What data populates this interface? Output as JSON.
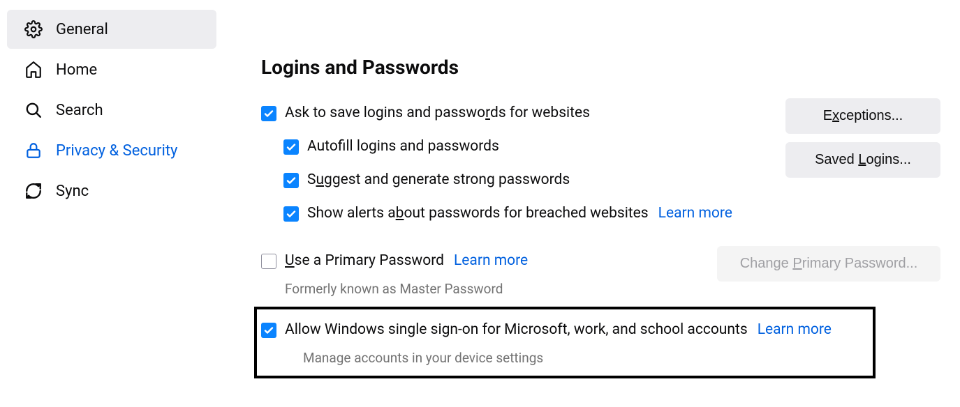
{
  "sidebar": {
    "items": [
      {
        "label": "General"
      },
      {
        "label": "Home"
      },
      {
        "label": "Search"
      },
      {
        "label": "Privacy & Security"
      },
      {
        "label": "Sync"
      }
    ]
  },
  "section": {
    "title": "Logins and Passwords"
  },
  "options": {
    "ask_save_pre": "Ask to save logins and passwo",
    "ask_save_key": "r",
    "ask_save_post": "ds for websites",
    "autofill_pre": "Autof",
    "autofill_key": "i",
    "autofill_post": "ll logins and passwords",
    "suggest_pre": "S",
    "suggest_key": "u",
    "suggest_post": "ggest and generate strong passwords",
    "breach_pre": "Show alerts a",
    "breach_key": "b",
    "breach_post": "out passwords for breached websites",
    "primary_pre": "",
    "primary_key": "U",
    "primary_post": "se a Primary Password",
    "primary_hint": "Formerly known as Master Password",
    "sso_label": "Allow Windows single sign-on for Microsoft, work, and school accounts",
    "sso_hint": "Manage accounts in your device settings",
    "learn_more": "Learn more"
  },
  "buttons": {
    "exceptions_pre": "E",
    "exceptions_key": "x",
    "exceptions_post": "ceptions...",
    "saved_pre": "Saved ",
    "saved_key": "L",
    "saved_post": "ogins...",
    "change_pre": "Change ",
    "change_key": "P",
    "change_post": "rimary Password..."
  }
}
